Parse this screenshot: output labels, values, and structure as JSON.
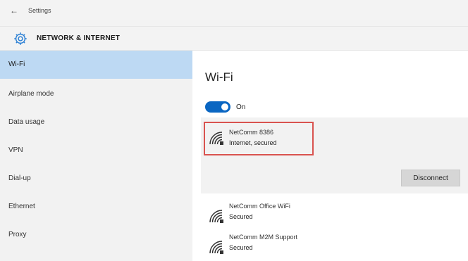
{
  "window": {
    "back_glyph": "←",
    "title": "Settings"
  },
  "header": {
    "icon": "gear-icon",
    "title": "NETWORK & INTERNET"
  },
  "sidebar": {
    "items": [
      {
        "label": "Wi-Fi",
        "selected": true
      },
      {
        "label": "Airplane mode",
        "selected": false
      },
      {
        "label": "Data usage",
        "selected": false
      },
      {
        "label": "VPN",
        "selected": false
      },
      {
        "label": "Dial-up",
        "selected": false
      },
      {
        "label": "Ethernet",
        "selected": false
      },
      {
        "label": "Proxy",
        "selected": false
      }
    ]
  },
  "main": {
    "title": "Wi-Fi",
    "toggle": {
      "state": "On"
    },
    "networks": [
      {
        "name": "NetComm 8386",
        "status": "Internet, secured",
        "connected": true
      },
      {
        "name": "NetComm Office WiFi",
        "status": "Secured",
        "connected": false
      },
      {
        "name": "NetComm M2M Support",
        "status": "Secured",
        "connected": false
      }
    ],
    "disconnect_label": "Disconnect"
  },
  "colors": {
    "accent": "#0a66c2",
    "selected_nav": "#bdd9f3",
    "highlight": "#d9534f"
  }
}
